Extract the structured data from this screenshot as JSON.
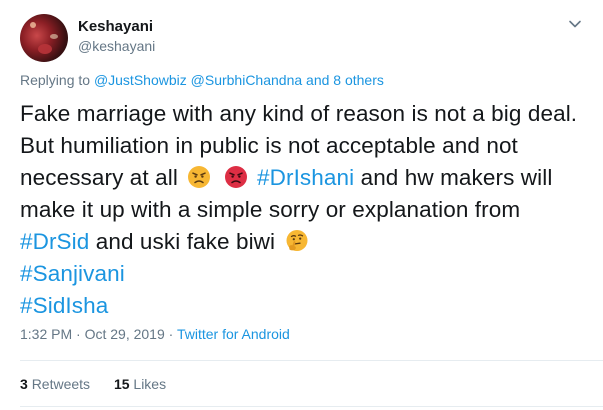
{
  "user": {
    "display_name": "Keshayani",
    "handle": "@keshayani"
  },
  "reply_to": {
    "prefix": "Replying to",
    "mention1": "@JustShowbiz",
    "mention2": "@SurbhiChandna",
    "suffix": "and 8 others"
  },
  "tweet": {
    "line1": "Fake marriage with any kind of reason is not a big deal.",
    "line2": "But humiliation in public is not acceptable and not",
    "line3_a": "necessary at all",
    "line3_hashtag": "#DrIshani",
    "line3_b": "and hw makers will",
    "line4": "make it up with a simple sorry or explanation from",
    "line5_hashtag": "#DrSid",
    "line5_b": "and uski fake biwi",
    "hashtag_sanjivani": "#Sanjivani",
    "hashtag_sidisha": "#SidIsha",
    "emoji1": "angry-face-emoji",
    "emoji2": "pouting-face-emoji",
    "emoji3": "thinking-face-emoji"
  },
  "meta": {
    "time": "1:32 PM",
    "separator1": "·",
    "date": "Oct 29, 2019",
    "separator2": "·",
    "source": "Twitter for Android"
  },
  "stats": {
    "retweets_count": "3",
    "retweets_label": "Retweets",
    "likes_count": "15",
    "likes_label": "Likes"
  },
  "colors": {
    "link": "#1b95e0",
    "secondary": "#657786",
    "text": "#14171a",
    "divider": "#e6ecf0"
  }
}
